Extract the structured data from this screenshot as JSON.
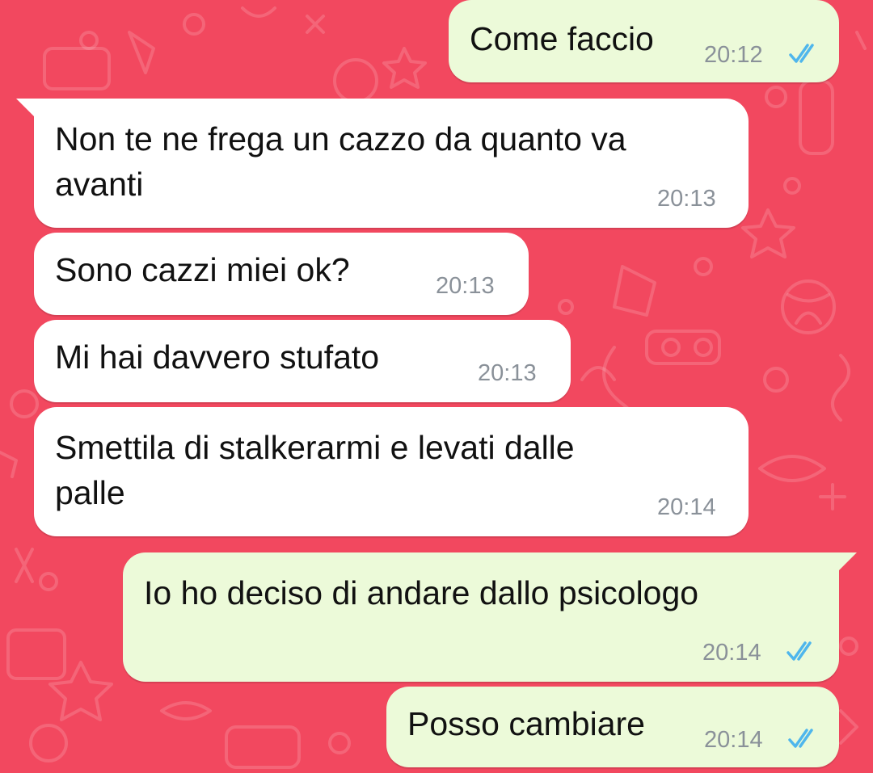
{
  "theme": {
    "background": "#f2485f",
    "incoming_bubble": "#ffffff",
    "outgoing_bubble": "#ecfad9",
    "read_ticks": "#4fb6ec",
    "time_text": "#8a9199"
  },
  "messages": [
    {
      "direction": "out",
      "text": "Come faccio",
      "time": "20:12",
      "status": "read-ticks-icon"
    },
    {
      "direction": "in",
      "text": "Non te ne frega un cazzo da quanto va\navanti",
      "time": "20:13"
    },
    {
      "direction": "in",
      "text": "Sono cazzi miei ok?",
      "time": "20:13"
    },
    {
      "direction": "in",
      "text": "Mi hai davvero stufato",
      "time": "20:13"
    },
    {
      "direction": "in",
      "text": "Smettila di stalkerarmi e levati dalle\npalle",
      "time": "20:14"
    },
    {
      "direction": "out",
      "text": "Io ho deciso di andare dallo psicologo",
      "time": "20:14",
      "status": "read-ticks-icon"
    },
    {
      "direction": "out",
      "text": "Posso cambiare",
      "time": "20:14",
      "status": "read-ticks-icon"
    }
  ]
}
